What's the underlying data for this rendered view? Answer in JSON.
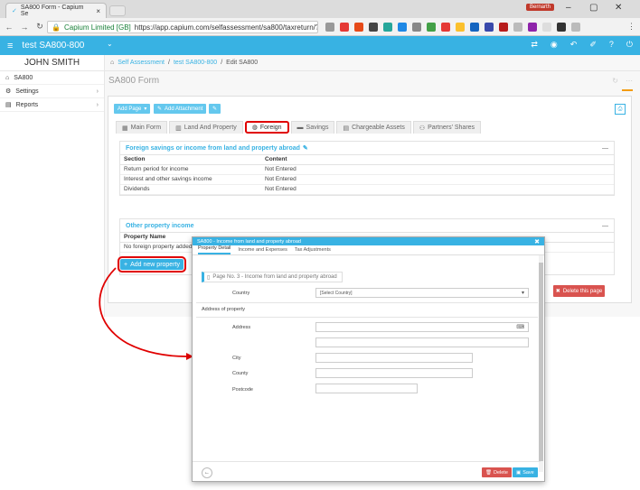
{
  "browser": {
    "tab_title": "SA800 Form - Capium Se",
    "tab_close": "×",
    "user_badge": "Bernarth",
    "url_secure_label": "Capium Limited [GB]",
    "url": "https://app.capium.com/selfassessment/sa800/taxreturn/?...",
    "colors": {
      "tab_bar": "#dcdcdc",
      "secure": "#188038"
    }
  },
  "app": {
    "title": "test SA800-800",
    "accent": "#38b2e3"
  },
  "sidebar": {
    "user_name": "JOHN SMITH",
    "items": [
      {
        "label": "SA800",
        "icon": "home-icon"
      },
      {
        "label": "Settings",
        "icon": "gear-icon"
      },
      {
        "label": "Reports",
        "icon": "file-icon"
      }
    ]
  },
  "breadcrumb": {
    "items": [
      "Self Assessment",
      "test SA800-800",
      "Edit SA800"
    ]
  },
  "page": {
    "title": "SA800 Form",
    "toolbar": {
      "add_page": "Add Page",
      "add_attachment": "Add Attachment"
    },
    "tabs": [
      "Main Form",
      "Land And Property",
      "Foreign",
      "Savings",
      "Chargeable Assets",
      "Partners' Shares"
    ],
    "active_tab": "Foreign",
    "section1": {
      "title": "Foreign savings or income from land and property abroad",
      "columns": [
        "Section",
        "Content"
      ],
      "rows": [
        [
          "Return period for income",
          "Not Entered"
        ],
        [
          "Interest and other savings income",
          "Not Entered"
        ],
        [
          "Dividends",
          "Not Entered"
        ]
      ]
    },
    "section2": {
      "title": "Other property income",
      "column": "Property Name",
      "empty_text": "No foreign property added",
      "add_button": "Add new property"
    },
    "delete_page_button": "Delete this page"
  },
  "modal": {
    "title": "SA800 - Income from land and property abroad",
    "tabs": [
      "Property Detail",
      "Income and Expenses",
      "Tax Adjustments"
    ],
    "active_tab": "Property Detail",
    "page_label": "Page No. 3 - Income from land and property abroad",
    "country_label": "Country",
    "country_value": "[Select Country]",
    "address_section": "Address of property",
    "address_label": "Address",
    "city_label": "City",
    "county_label": "County",
    "postcode_label": "Postcode",
    "delete_button": "Delete",
    "save_button": "Save"
  },
  "annotation_color": "#e00000"
}
